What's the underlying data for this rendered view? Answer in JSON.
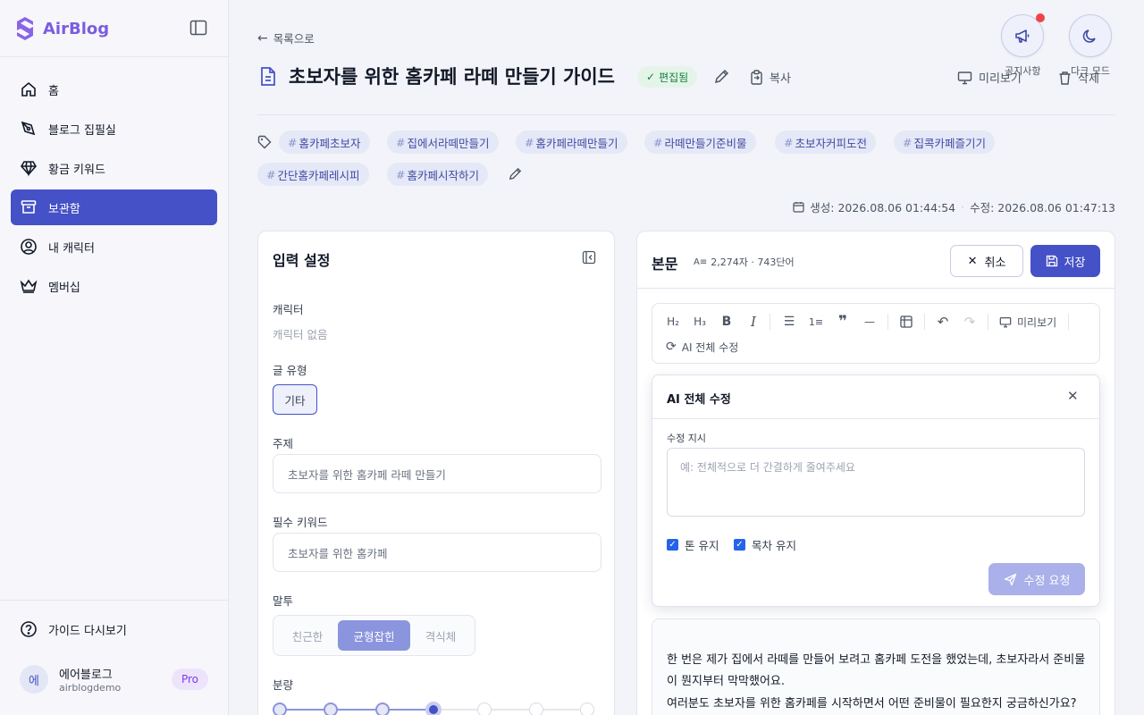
{
  "app": {
    "name": "AirBlog"
  },
  "sidebar": {
    "items": [
      {
        "label": "홈",
        "icon": "home-icon"
      },
      {
        "label": "블로그 집필실",
        "icon": "pen-nib-icon"
      },
      {
        "label": "황금 키워드",
        "icon": "gem-icon"
      },
      {
        "label": "보관함",
        "icon": "archive-icon",
        "active": true
      },
      {
        "label": "내 캐릭터",
        "icon": "user-circle-icon"
      },
      {
        "label": "멤버십",
        "icon": "crown-icon"
      }
    ],
    "guide_label": "가이드 다시보기",
    "user": {
      "avatar": "에",
      "name": "에어블로그",
      "id": "airblogdemo",
      "plan": "Pro"
    }
  },
  "header": {
    "back_label": "목록으로",
    "title": "초보자를 위한 홈카페 라떼 만들기 가이드",
    "badge": "편집됨",
    "copy_label": "복사",
    "preview_label": "미리보기",
    "delete_label": "삭제",
    "notice_label": "공지사항",
    "darkmode_label": "다크 모드"
  },
  "tags": [
    "홈카페초보자",
    "집에서라떼만들기",
    "홈카페라떼만들기",
    "라떼만들기준비물",
    "초보자커피도전",
    "집콕카페즐기기",
    "간단홈카페레시피",
    "홈카페시작하기"
  ],
  "dates": {
    "created": "생성: 2026.08.06 01:44:54",
    "modified": "수정: 2026.08.06 01:47:13"
  },
  "input_panel": {
    "title": "입력 설정",
    "character_label": "캐릭터",
    "character_value": "캐릭터 없음",
    "type_label": "글 유형",
    "type_value": "기타",
    "topic_label": "주제",
    "topic_value": "초보자를 위한 홈카페 라떼 만들기",
    "keyword_label": "필수 키워드",
    "keyword_value": "초보자를 위한 홈카페",
    "tone_label": "말투",
    "tone_options": [
      "친근한",
      "균형잡힌",
      "격식체"
    ],
    "tone_selected": "균형잡힌",
    "amount_label": "분량",
    "amount_level": 4,
    "amount_steps": 7
  },
  "editor": {
    "title": "본문",
    "stats": "2,274자 · 743단어",
    "cancel_label": "취소",
    "save_label": "저장",
    "toolbar": {
      "preview_label": "미리보기",
      "ai_label": "AI 전체 수정"
    },
    "ai": {
      "title": "AI 전체 수정",
      "instruction_label": "수정 지시",
      "placeholder": "예: 전체적으로 더 간결하게 줄여주세요",
      "keep_tone": "톤 유지",
      "keep_toc": "목차 유지",
      "submit": "수정 요청"
    },
    "body": [
      "한 번은 제가 집에서 라떼를 만들어 보려고 홈카페 도전을 했었는데, 초보자라서 준비물",
      "이 뭔지부터 막막했어요.",
      "여러분도 초보자를 위한 홈카페를 시작하면서 어떤 준비물이 필요한지 궁금하신가요?"
    ]
  },
  "colors": {
    "accent": "#4551c6",
    "brand": "#7c5ce0",
    "success": "#15803d"
  }
}
